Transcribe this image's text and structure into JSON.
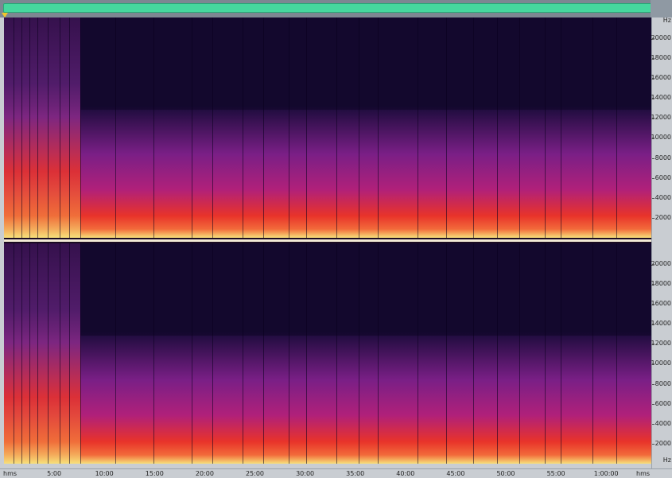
{
  "overview": {
    "accent": "#46d89e"
  },
  "frequency_axis": {
    "unit": "Hz",
    "labels": [
      "20000",
      "18000",
      "16000",
      "14000",
      "12000",
      "10000",
      "8000",
      "6000",
      "4000",
      "2000"
    ]
  },
  "time_axis": {
    "unit_left": "hms",
    "unit_right": "hms",
    "labels": [
      "5:00",
      "10:00",
      "15:00",
      "20:00",
      "25:00",
      "30:00",
      "35:00",
      "40:00",
      "45:00",
      "50:00",
      "55:00",
      "1:00:00"
    ]
  },
  "colors": {
    "spectrum_low": "#1a0b3a",
    "spectrum_mid": "#7a1f86",
    "spectrum_high": "#e8332a",
    "spectrum_peak": "#f7e07a"
  },
  "channels": [
    "channel-1",
    "channel-2"
  ]
}
